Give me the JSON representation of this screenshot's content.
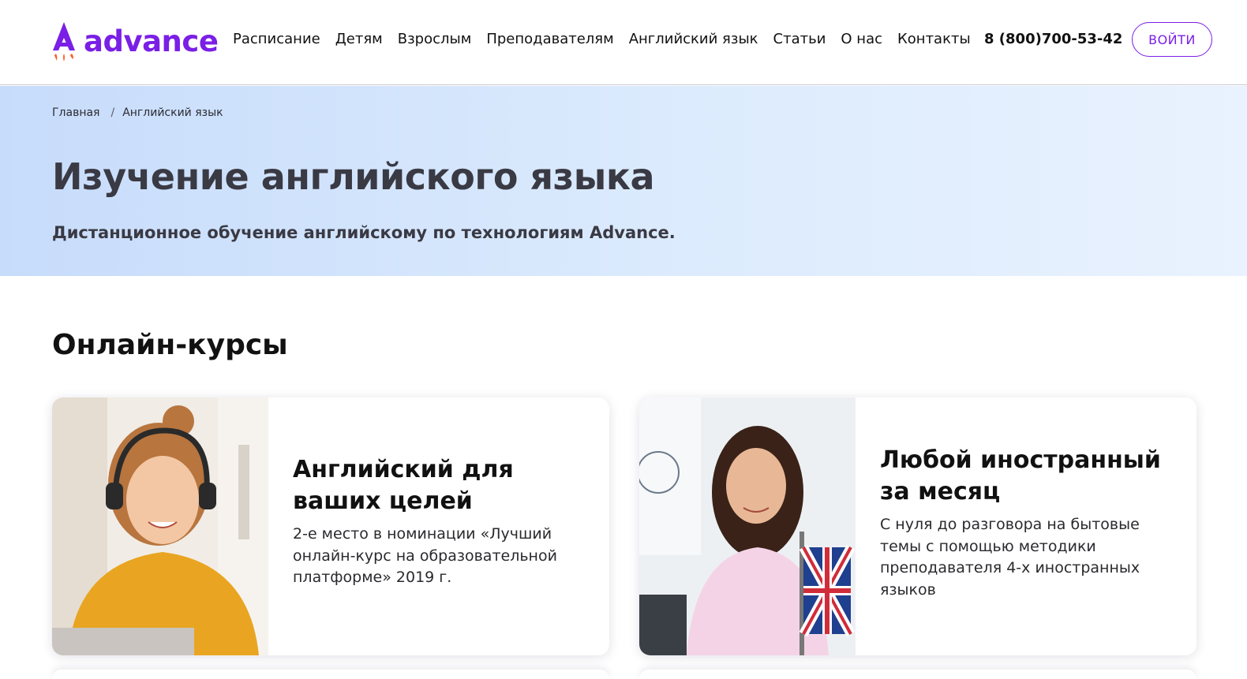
{
  "header": {
    "logo_text": "advance",
    "nav": [
      {
        "label": "Расписание"
      },
      {
        "label": "Детям"
      },
      {
        "label": "Взрослым"
      },
      {
        "label": "Преподавателям"
      },
      {
        "label": "Английский язык"
      },
      {
        "label": "Статьи"
      },
      {
        "label": "О нас"
      },
      {
        "label": "Контакты"
      }
    ],
    "phone": "8 (800)700-53-42",
    "login_label": "ВОЙТИ"
  },
  "breadcrumb": {
    "home": "Главная",
    "separator": "/",
    "current": "Английский язык"
  },
  "hero": {
    "title": "Изучение английского языка",
    "subtitle": "Дистанционное обучение английскому по технологиям Advance."
  },
  "courses": {
    "section_title": "Онлайн-курсы",
    "items": [
      {
        "title": "Английский для ваших целей",
        "description": "2-е место в номинации «Лучший онлайн-курс на образовательной платформе» 2019 г."
      },
      {
        "title": "Любой иностранный за месяц",
        "description": "С нуля до разговора на бытовые темы с помощью методики преподавателя 4-х иностранных языков"
      }
    ]
  },
  "colors": {
    "brand": "#7a1fe6",
    "accent_orange": "#ff5a1f",
    "hero_bg": "#d6e7fc"
  }
}
